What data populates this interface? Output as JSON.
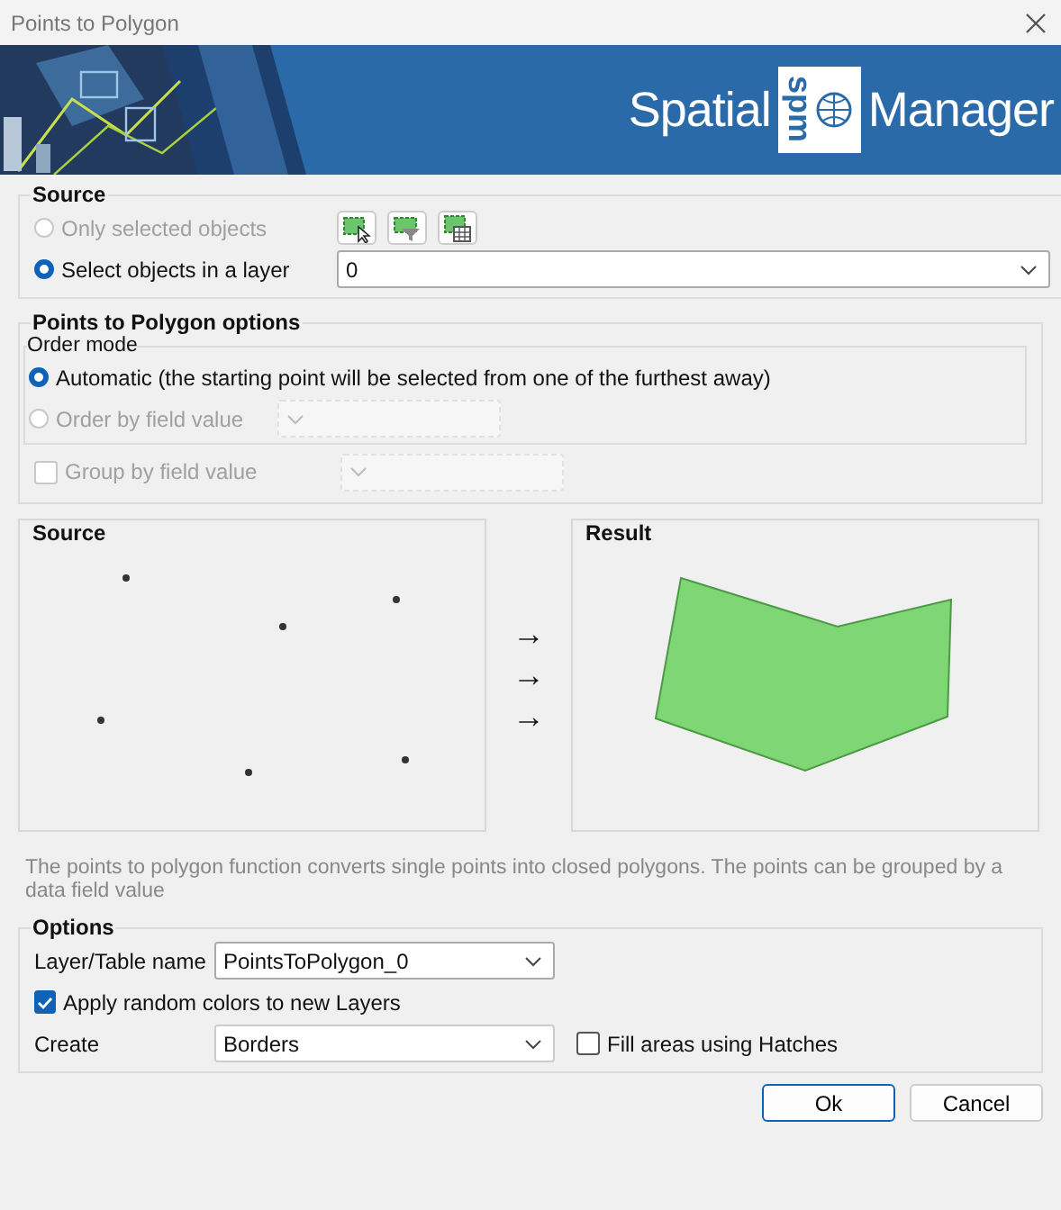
{
  "window": {
    "title": "Points to Polygon"
  },
  "banner": {
    "logo_left": "Spatial",
    "logo_badge": "spm",
    "logo_right": "Manager"
  },
  "source": {
    "title": "Source",
    "layer": "0",
    "options": [
      {
        "label": "Only selected objects",
        "selected": false,
        "disabled": true
      },
      {
        "label": "Select objects in a layer",
        "selected": true,
        "disabled": false
      }
    ]
  },
  "polygon_options": {
    "title": "Points to Polygon options",
    "order_mode": {
      "title": "Order mode",
      "options": [
        {
          "label": "Automatic (the starting point will be selected from one of the furthest away)",
          "selected": true,
          "disabled": false
        },
        {
          "label": "Order by field value",
          "selected": false,
          "disabled": true
        }
      ]
    },
    "group_by": {
      "label": "Group by field value",
      "checked": false,
      "disabled": true
    }
  },
  "preview": {
    "source_title": "Source",
    "result_title": "Result",
    "arrows": [
      "→",
      "→",
      "→"
    ]
  },
  "description": "The points to polygon function converts single points into closed polygons. The points can be grouped by a data field value",
  "options": {
    "title": "Options",
    "layer_label": "Layer/Table name",
    "layer_value": "PointsToPolygon_0",
    "random_colors": {
      "label": "Apply random colors to new Layers",
      "checked": true
    },
    "create_label": "Create",
    "create_value": "Borders",
    "hatches": {
      "label": "Fill areas using Hatches",
      "checked": false
    }
  },
  "buttons": [
    {
      "label": "Ok",
      "default": true
    },
    {
      "label": "Cancel",
      "default": false
    }
  ]
}
